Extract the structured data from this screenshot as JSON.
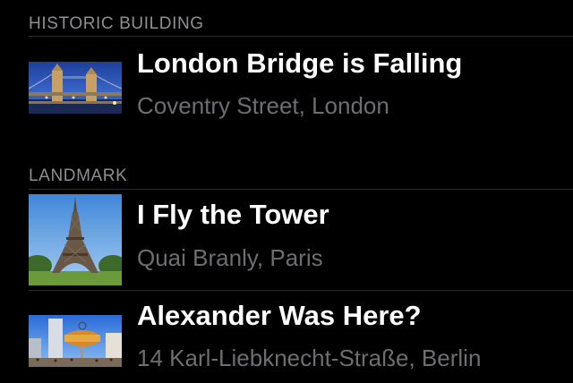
{
  "sections": [
    {
      "header": "HISTORIC BUILDING",
      "items": [
        {
          "title": "London Bridge is Falling",
          "subtitle": "Coventry Street, London",
          "thumbnail": "tower-bridge-photo"
        }
      ]
    },
    {
      "header": "LANDMARK",
      "items": [
        {
          "title": "I Fly the Tower",
          "subtitle": "Quai Branly, Paris",
          "thumbnail": "eiffel-tower-photo"
        },
        {
          "title": "Alexander Was Here?",
          "subtitle": "14 Karl-Liebknecht-Straße, Berlin",
          "thumbnail": "world-clock-alexanderplatz-photo"
        }
      ]
    }
  ],
  "colors": {
    "background": "#000000",
    "title": "#ffffff",
    "subtitle": "#6d6d72",
    "header": "#8e8e93",
    "divider": "#2a2a2c"
  }
}
